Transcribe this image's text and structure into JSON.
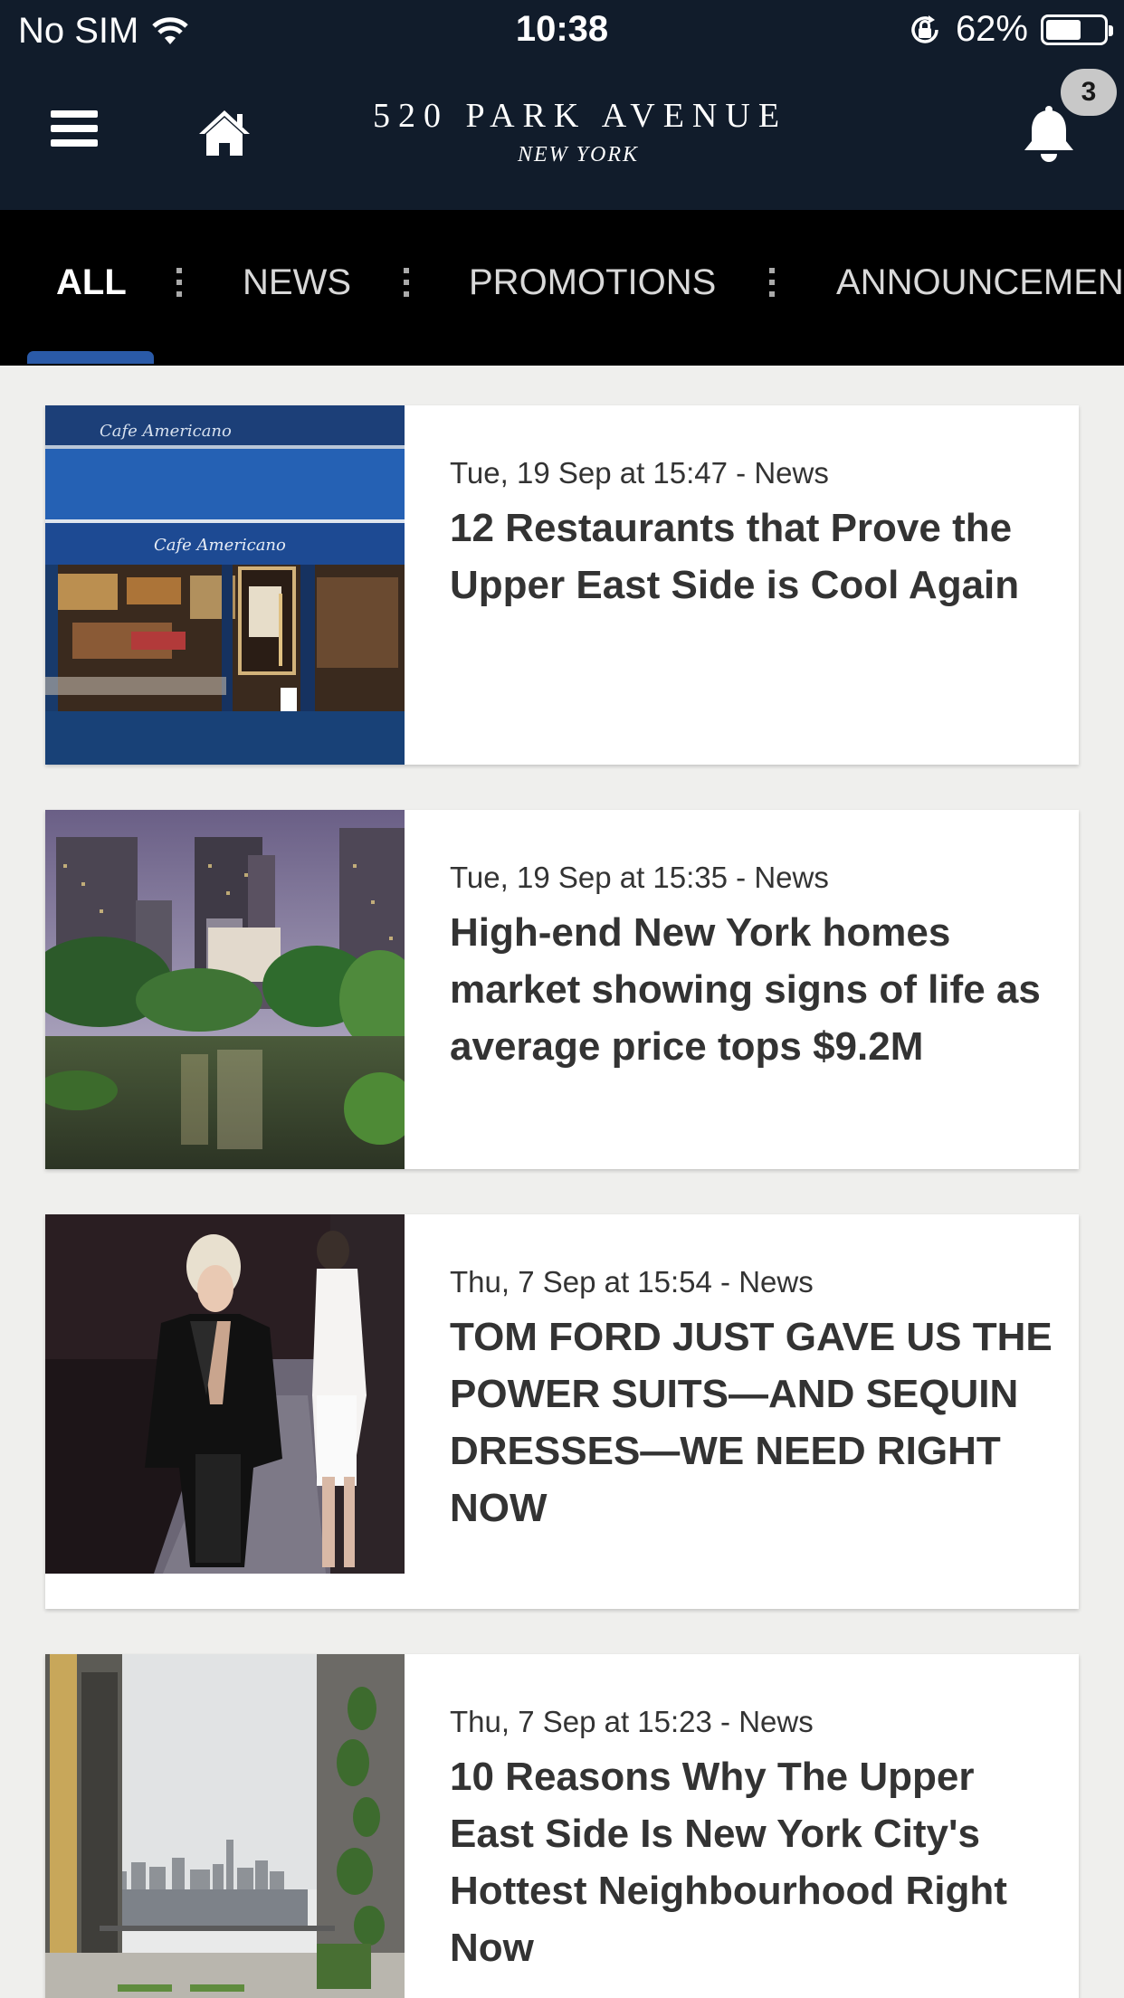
{
  "status_bar": {
    "carrier": "No SIM",
    "time": "10:38",
    "battery_percent": "62%",
    "battery_level": 0.62
  },
  "header": {
    "brand_title": "520 PARK AVENUE",
    "brand_subtitle": "NEW YORK",
    "notification_count": "3"
  },
  "tabs": [
    {
      "label": "ALL",
      "active": true
    },
    {
      "label": "NEWS",
      "active": false
    },
    {
      "label": "PROMOTIONS",
      "active": false
    },
    {
      "label": "ANNOUNCEMEN",
      "active": false
    }
  ],
  "articles": [
    {
      "meta": "Tue, 19 Sep at 15:47 - News",
      "title": "12 Restaurants that Prove the Upper East Side is Cool Again",
      "image_caption": "Cafe Americano"
    },
    {
      "meta": "Tue, 19 Sep at 15:35 - News",
      "title": "High-end New York homes market showing signs of life as average price tops $9.2M"
    },
    {
      "meta": "Thu, 7 Sep at 15:54 - News",
      "title": "TOM FORD JUST GAVE US THE POWER SUITS—AND SEQUIN DRESSES—WE NEED RIGHT NOW"
    },
    {
      "meta": "Thu, 7 Sep at 15:23 - News",
      "title": "10 Reasons Why The Upper East Side Is New York City's Hottest Neighbourhood Right Now"
    }
  ]
}
